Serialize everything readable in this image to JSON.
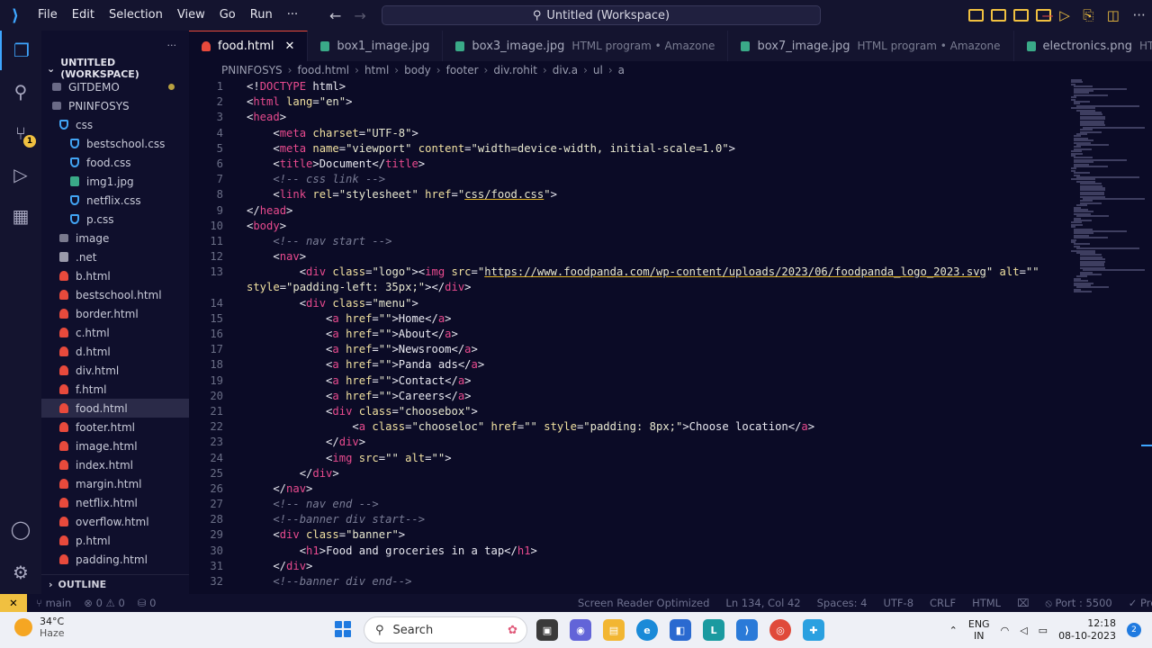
{
  "titlebar": {
    "menu": [
      "File",
      "Edit",
      "Selection",
      "View",
      "Go",
      "Run",
      "···"
    ],
    "search_text": "Untitled (Workspace)"
  },
  "activity": {
    "source_control_badge": "1"
  },
  "sidebar": {
    "more": "···",
    "workspace_title": "UNTITLED (WORKSPACE)",
    "items": [
      {
        "label": "GITDEMO",
        "icon": "git",
        "indent": 1,
        "dot": true
      },
      {
        "label": "PNINFOSYS",
        "icon": "git",
        "indent": 1
      },
      {
        "label": "css",
        "icon": "css",
        "indent": 2
      },
      {
        "label": "bestschool.css",
        "icon": "css",
        "indent": 3
      },
      {
        "label": "food.css",
        "icon": "css",
        "indent": 3
      },
      {
        "label": "img1.jpg",
        "icon": "img",
        "indent": 3
      },
      {
        "label": "netflix.css",
        "icon": "css",
        "indent": 3
      },
      {
        "label": "p.css",
        "icon": "css",
        "indent": 3
      },
      {
        "label": "image",
        "icon": "folder",
        "indent": 2
      },
      {
        "label": ".net",
        "icon": "net",
        "indent": 2
      },
      {
        "label": "b.html",
        "icon": "html",
        "indent": 2
      },
      {
        "label": "bestschool.html",
        "icon": "html",
        "indent": 2
      },
      {
        "label": "border.html",
        "icon": "html",
        "indent": 2
      },
      {
        "label": "c.html",
        "icon": "html",
        "indent": 2
      },
      {
        "label": "d.html",
        "icon": "html",
        "indent": 2
      },
      {
        "label": "div.html",
        "icon": "html",
        "indent": 2
      },
      {
        "label": "f.html",
        "icon": "html",
        "indent": 2
      },
      {
        "label": "food.html",
        "icon": "html",
        "indent": 2,
        "selected": true
      },
      {
        "label": "footer.html",
        "icon": "html",
        "indent": 2
      },
      {
        "label": "image.html",
        "icon": "html",
        "indent": 2
      },
      {
        "label": "index.html",
        "icon": "html",
        "indent": 2
      },
      {
        "label": "margin.html",
        "icon": "html",
        "indent": 2
      },
      {
        "label": "netflix.html",
        "icon": "html",
        "indent": 2
      },
      {
        "label": "overflow.html",
        "icon": "html",
        "indent": 2
      },
      {
        "label": "p.html",
        "icon": "html",
        "indent": 2
      },
      {
        "label": "padding.html",
        "icon": "html",
        "indent": 2
      }
    ],
    "outline": "OUTLINE"
  },
  "tabs": [
    {
      "label": "food.html",
      "icon": "html",
      "active": true,
      "close": "✕"
    },
    {
      "label": "box1_image.jpg",
      "icon": "img"
    },
    {
      "label": "box3_image.jpg",
      "icon": "img",
      "desc": "HTML program • Amazone"
    },
    {
      "label": "box7_image.jpg",
      "icon": "img",
      "desc": "HTML program • Amazone"
    },
    {
      "label": "electronics.png",
      "icon": "img",
      "desc": "HT"
    }
  ],
  "breadcrumb": [
    "PNINFOSYS",
    "food.html",
    "html",
    "body",
    "footer",
    "div.rohit",
    "div.a",
    "ul",
    "a"
  ],
  "code_lines": [
    [
      [
        "p",
        "<!"
      ],
      [
        "t",
        "DOCTYPE"
      ],
      [
        "p",
        " html>"
      ]
    ],
    [
      [
        "p",
        "<"
      ],
      [
        "t",
        "html"
      ],
      [
        "a",
        " lang"
      ],
      [
        "p",
        "="
      ],
      [
        "s",
        "\"en\""
      ],
      [
        "p",
        ">"
      ]
    ],
    [
      [
        "p",
        "<"
      ],
      [
        "t",
        "head"
      ],
      [
        "p",
        ">"
      ]
    ],
    [
      [
        "p",
        "    <"
      ],
      [
        "t",
        "meta"
      ],
      [
        "a",
        " charset"
      ],
      [
        "p",
        "="
      ],
      [
        "s",
        "\"UTF-8\""
      ],
      [
        "p",
        ">"
      ]
    ],
    [
      [
        "p",
        "    <"
      ],
      [
        "t",
        "meta"
      ],
      [
        "a",
        " name"
      ],
      [
        "p",
        "="
      ],
      [
        "s",
        "\"viewport\""
      ],
      [
        "a",
        " content"
      ],
      [
        "p",
        "="
      ],
      [
        "s",
        "\"width=device-width, initial-scale=1.0\""
      ],
      [
        "p",
        ">"
      ]
    ],
    [
      [
        "p",
        "    <"
      ],
      [
        "t",
        "title"
      ],
      [
        "p",
        ">Document</"
      ],
      [
        "t",
        "title"
      ],
      [
        "p",
        ">"
      ]
    ],
    [
      [
        "c",
        "    <!-- css link -->"
      ]
    ],
    [
      [
        "p",
        "    <"
      ],
      [
        "t",
        "link"
      ],
      [
        "a",
        " rel"
      ],
      [
        "p",
        "="
      ],
      [
        "s",
        "\"stylesheet\""
      ],
      [
        "a",
        " href"
      ],
      [
        "p",
        "="
      ],
      [
        "s",
        "\""
      ],
      [
        "u",
        "css/food.css"
      ],
      [
        "s",
        "\""
      ],
      [
        "p",
        ">"
      ]
    ],
    [
      [
        "p",
        "</"
      ],
      [
        "t",
        "head"
      ],
      [
        "p",
        ">"
      ]
    ],
    [
      [
        "p",
        "<"
      ],
      [
        "t",
        "body"
      ],
      [
        "p",
        ">"
      ]
    ],
    [
      [
        "c",
        "    <!-- nav start -->"
      ]
    ],
    [
      [
        "p",
        "    <"
      ],
      [
        "t",
        "nav"
      ],
      [
        "p",
        ">"
      ]
    ],
    [
      [
        "p",
        "        <"
      ],
      [
        "t",
        "div"
      ],
      [
        "a",
        " class"
      ],
      [
        "p",
        "="
      ],
      [
        "s",
        "\"logo\""
      ],
      [
        "p",
        "><"
      ],
      [
        "t",
        "img"
      ],
      [
        "a",
        " src"
      ],
      [
        "p",
        "="
      ],
      [
        "s",
        "\""
      ],
      [
        "u",
        "https://www.foodpanda.com/wp-content/uploads/2023/06/foodpanda_logo_2023.svg"
      ],
      [
        "s",
        "\""
      ],
      [
        "a",
        " alt"
      ],
      [
        "p",
        "="
      ],
      [
        "s",
        "\"\""
      ]
    ],
    [
      [
        "a",
        "style"
      ],
      [
        "p",
        "="
      ],
      [
        "s",
        "\"padding-left: 35px;\""
      ],
      [
        "p",
        "></"
      ],
      [
        "t",
        "div"
      ],
      [
        "p",
        ">"
      ]
    ],
    [
      [
        "p",
        "        <"
      ],
      [
        "t",
        "div"
      ],
      [
        "a",
        " class"
      ],
      [
        "p",
        "="
      ],
      [
        "s",
        "\"menu\""
      ],
      [
        "p",
        ">"
      ]
    ],
    [
      [
        "p",
        "            <"
      ],
      [
        "t",
        "a"
      ],
      [
        "a",
        " href"
      ],
      [
        "p",
        "="
      ],
      [
        "s",
        "\"\""
      ],
      [
        "p",
        ">Home</"
      ],
      [
        "t",
        "a"
      ],
      [
        "p",
        ">"
      ]
    ],
    [
      [
        "p",
        "            <"
      ],
      [
        "t",
        "a"
      ],
      [
        "a",
        " href"
      ],
      [
        "p",
        "="
      ],
      [
        "s",
        "\"\""
      ],
      [
        "p",
        ">About</"
      ],
      [
        "t",
        "a"
      ],
      [
        "p",
        ">"
      ]
    ],
    [
      [
        "p",
        "            <"
      ],
      [
        "t",
        "a"
      ],
      [
        "a",
        " href"
      ],
      [
        "p",
        "="
      ],
      [
        "s",
        "\"\""
      ],
      [
        "p",
        ">Newsroom</"
      ],
      [
        "t",
        "a"
      ],
      [
        "p",
        ">"
      ]
    ],
    [
      [
        "p",
        "            <"
      ],
      [
        "t",
        "a"
      ],
      [
        "a",
        " href"
      ],
      [
        "p",
        "="
      ],
      [
        "s",
        "\"\""
      ],
      [
        "p",
        ">Panda ads</"
      ],
      [
        "t",
        "a"
      ],
      [
        "p",
        ">"
      ]
    ],
    [
      [
        "p",
        "            <"
      ],
      [
        "t",
        "a"
      ],
      [
        "a",
        " href"
      ],
      [
        "p",
        "="
      ],
      [
        "s",
        "\"\""
      ],
      [
        "p",
        ">Contact</"
      ],
      [
        "t",
        "a"
      ],
      [
        "p",
        ">"
      ]
    ],
    [
      [
        "p",
        "            <"
      ],
      [
        "t",
        "a"
      ],
      [
        "a",
        " href"
      ],
      [
        "p",
        "="
      ],
      [
        "s",
        "\"\""
      ],
      [
        "p",
        ">Careers</"
      ],
      [
        "t",
        "a"
      ],
      [
        "p",
        ">"
      ]
    ],
    [
      [
        "p",
        "            <"
      ],
      [
        "t",
        "div"
      ],
      [
        "a",
        " class"
      ],
      [
        "p",
        "="
      ],
      [
        "s",
        "\"choosebox\""
      ],
      [
        "p",
        ">"
      ]
    ],
    [
      [
        "p",
        "                <"
      ],
      [
        "t",
        "a"
      ],
      [
        "a",
        " class"
      ],
      [
        "p",
        "="
      ],
      [
        "s",
        "\"chooseloc\""
      ],
      [
        "a",
        " href"
      ],
      [
        "p",
        "="
      ],
      [
        "s",
        "\"\""
      ],
      [
        "a",
        " style"
      ],
      [
        "p",
        "="
      ],
      [
        "s",
        "\"padding: 8px;\""
      ],
      [
        "p",
        ">Choose location</"
      ],
      [
        "t",
        "a"
      ],
      [
        "p",
        ">"
      ]
    ],
    [
      [
        "p",
        "            </"
      ],
      [
        "t",
        "div"
      ],
      [
        "p",
        ">"
      ]
    ],
    [
      [
        "p",
        "            <"
      ],
      [
        "t",
        "img"
      ],
      [
        "a",
        " src"
      ],
      [
        "p",
        "="
      ],
      [
        "s",
        "\"\""
      ],
      [
        "a",
        " alt"
      ],
      [
        "p",
        "="
      ],
      [
        "s",
        "\"\""
      ],
      [
        "p",
        ">"
      ]
    ],
    [
      [
        "p",
        "        </"
      ],
      [
        "t",
        "div"
      ],
      [
        "p",
        ">"
      ]
    ],
    [
      [
        "p",
        "    </"
      ],
      [
        "t",
        "nav"
      ],
      [
        "p",
        ">"
      ]
    ],
    [
      [
        "c",
        "    <!-- nav end -->"
      ]
    ],
    [
      [
        "c",
        "    <!--banner div start-->"
      ]
    ],
    [
      [
        "p",
        "    <"
      ],
      [
        "t",
        "div"
      ],
      [
        "a",
        " class"
      ],
      [
        "p",
        "="
      ],
      [
        "s",
        "\"banner\""
      ],
      [
        "p",
        ">"
      ]
    ],
    [
      [
        "p",
        "        <"
      ],
      [
        "t",
        "h1"
      ],
      [
        "p",
        ">Food and groceries in a tap</"
      ],
      [
        "t",
        "h1"
      ],
      [
        "p",
        ">"
      ]
    ],
    [
      [
        "p",
        "    </"
      ],
      [
        "t",
        "div"
      ],
      [
        "p",
        ">"
      ]
    ],
    [
      [
        "c",
        "    <!--banner div end-->"
      ]
    ]
  ],
  "line_numbers": [
    "1",
    "2",
    "3",
    "4",
    "5",
    "6",
    "7",
    "8",
    "9",
    "10",
    "11",
    "12",
    "13",
    "",
    "14",
    "15",
    "16",
    "17",
    "18",
    "19",
    "20",
    "21",
    "22",
    "23",
    "24",
    "25",
    "26",
    "27",
    "28",
    "29",
    "30",
    "31",
    "32"
  ],
  "status": {
    "remote": "✕",
    "branch": "main",
    "problems": "⊗ 0 ⚠ 0",
    "ports": "⛁ 0",
    "screen_reader": "Screen Reader Optimized",
    "position": "Ln 134, Col 42",
    "spaces": "Spaces: 4",
    "encoding": "UTF-8",
    "eol": "CRLF",
    "language": "HTML",
    "port": "Port : 5500",
    "prettier": "Prettier"
  },
  "taskbar": {
    "temperature": "34°C",
    "weather": "Haze",
    "search_label": "Search",
    "lang_top": "ENG",
    "lang_bottom": "IN",
    "time": "12:18",
    "date": "08-10-2023",
    "notifications": "2"
  },
  "colors": {
    "accent": "#3ea6ff",
    "warning": "#f0c040",
    "tag": "#e84a8e",
    "editor_bg": "#0b0b26"
  }
}
